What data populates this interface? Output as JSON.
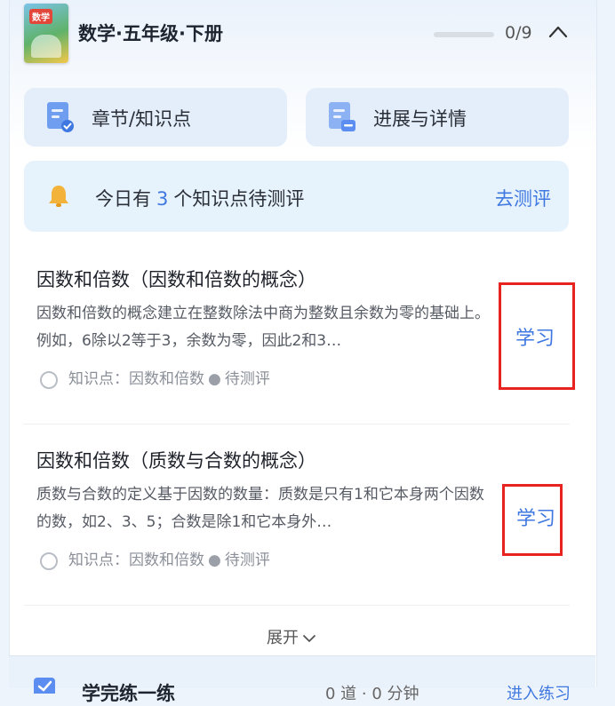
{
  "header": {
    "cover_text": "数学",
    "book_title": "数学·五年级·下册",
    "progress_text": "0/9",
    "progress_fraction": 0
  },
  "tiles": [
    {
      "label": "章节/知识点",
      "icon": "chapter-doc-icon"
    },
    {
      "label": "进展与详情",
      "icon": "progress-doc-icon"
    }
  ],
  "reminder": {
    "prefix": "今日有",
    "count": "3",
    "suffix": "个知识点待测评",
    "action": "去测评",
    "icon": "bell-icon"
  },
  "items": [
    {
      "title": "因数和倍数（因数和倍数的概念）",
      "desc": "因数和倍数的概念建立在整数除法中商为整数且余数为零的基础上。例如，6除以2等于3，余数为零，因此2和3…",
      "meta_label": "知识点：因数和倍数",
      "meta_dot": "●",
      "status": "待测评",
      "action": "学习"
    },
    {
      "title": "因数和倍数（质数与合数的概念）",
      "desc": "质数与合数的定义基于因数的数量：质数是只有1和它本身两个因数的数，如2、3、5；合数是除1和它本身外…",
      "meta_label": "知识点：因数和倍数",
      "meta_dot": "●",
      "status": "待测评",
      "action": "学习"
    }
  ],
  "expand_label": "展开",
  "bottom": {
    "title": "学完练一练",
    "stats": "0 道 · 0 分钟",
    "action": "进入练习"
  },
  "colors": {
    "accent": "#3f78e0",
    "highlight_box": "#e8231f"
  }
}
